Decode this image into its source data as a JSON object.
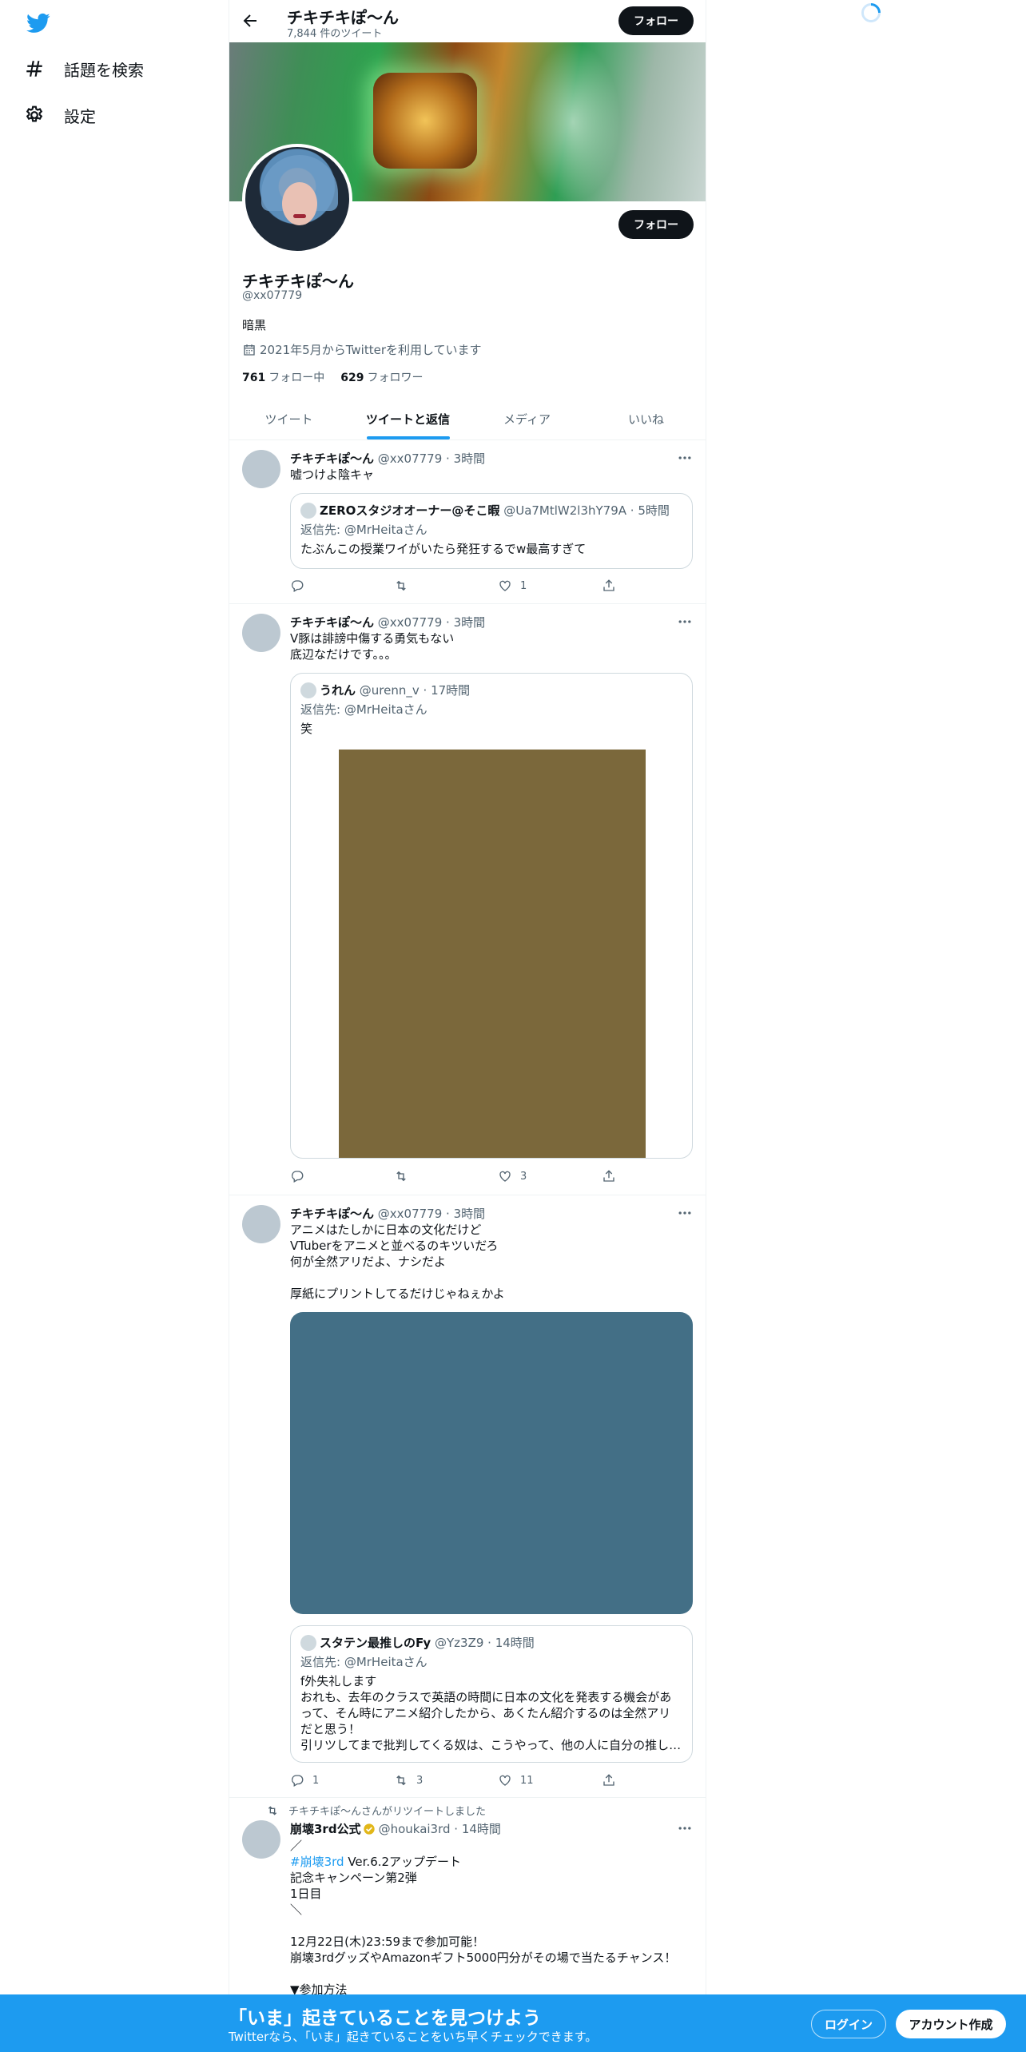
{
  "sidebar": {
    "logo": "twitter-bird-icon",
    "items": [
      {
        "label": "話題を検索",
        "icon": "hashtag-icon"
      },
      {
        "label": "設定",
        "icon": "gear-icon"
      }
    ]
  },
  "header": {
    "name": "チキチキぽ〜ん",
    "tweet_count": "7,844 件のツイート",
    "follow_label": "フォロー"
  },
  "profile": {
    "name": "チキチキぽ〜ん",
    "handle": "@xx07779",
    "bio": "暗黒",
    "joined": "2021年5月からTwitterを利用しています",
    "following_count": "761",
    "following_label": "フォロー中",
    "followers_count": "629",
    "followers_label": "フォロワー",
    "follow_label": "フォロー"
  },
  "tabs": [
    "ツイート",
    "ツイートと返信",
    "メディア",
    "いいね"
  ],
  "tweets": [
    {
      "name": "チキチキぽ〜ん",
      "meta": "@xx07779 · 3時間",
      "text": "嘘つけよ陰キャ",
      "quote": {
        "name": "ZEROスタジオオーナー@そこ暇",
        "meta": "@Ua7MtlW2l3hY79A · 5時間",
        "reply_to": "返信先: @MrHeitaさん",
        "text": "たぶんこの授業ワイがいたら発狂するでw最高すぎて"
      },
      "actions": {
        "reply": "",
        "retweet": "",
        "like": "1"
      }
    },
    {
      "name": "チキチキぽ〜ん",
      "meta": "@xx07779 · 3時間",
      "text": "V豚は誹謗中傷する勇気もない\n底辺なだけです。。。",
      "quote": {
        "name": "うれん",
        "meta": "@urenn_v · 17時間",
        "reply_to": "返信先: @MrHeitaさん",
        "text": "笑",
        "image_color": "#7b683b"
      },
      "actions": {
        "reply": "",
        "retweet": "",
        "like": "3"
      }
    },
    {
      "name": "チキチキぽ〜ん",
      "meta": "@xx07779 · 3時間",
      "text": "アニメはたしかに日本の文化だけど\nVTuberをアニメと並べるのキツいだろ\n何が全然アリだよ、ナシだよ\n\n厚紙にプリントしてるだけじゃねぇかよ",
      "image_color": "#436f86",
      "quote": {
        "name": "スタテン最推しのFy",
        "meta": "@Yz3Z9 · 14時間",
        "reply_to": "返信先: @MrHeitaさん",
        "text": "f外失礼します\nおれも、去年のクラスで英語の時間に日本の文化を発表する機会があって、そん時にアニメ紹介したから、あくたん紹介するのは全然アリだと思う！\n引リツしてまで批判してくる奴は、こうやって、他の人に自分の推し…"
      },
      "actions": {
        "reply": "1",
        "retweet": "3",
        "like": "11"
      }
    },
    {
      "retweet_label": "チキチキぽ〜んさんがリツイートしました",
      "name": "崩壊3rd公式",
      "meta": "@houkai3rd · 14時間",
      "text_top": "／",
      "hashtag": "#崩壊3rd",
      "text_after_tag": " Ver.6.2アップデート",
      "text_body": "記念キャンペーン第2弾\n1日目\n＼\n\n12月22日(木)23:59まで参加可能！\n崩壊3rdグッズやAmazonギフト5000円分がその場で当たるチャンス！\n\n▼参加方法"
    }
  ],
  "bottom_bar": {
    "title": "「いま」起きていることを見つけよう",
    "subtitle": "Twitterなら、「いま」起きていることをいち早くチェックできます。",
    "login": "ログイン",
    "signup": "アカウント作成"
  },
  "colors": {
    "accent": "#1d9bf0",
    "text": "#0f1419",
    "secondary": "#536471",
    "verified": "#e2b719"
  }
}
